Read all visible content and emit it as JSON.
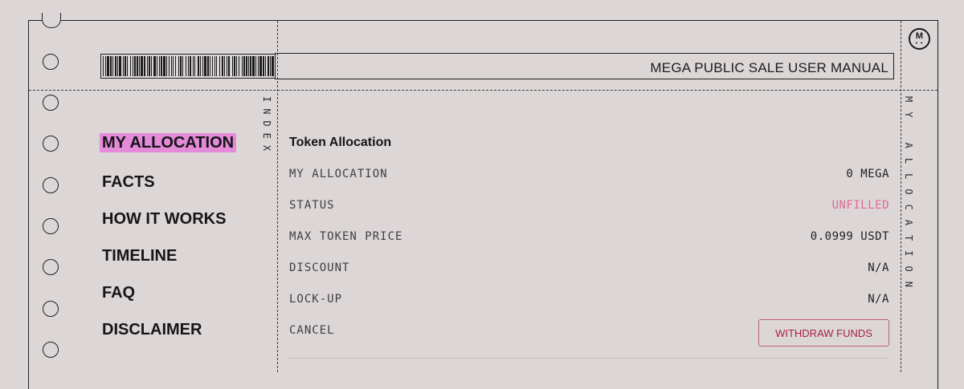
{
  "header": {
    "title": "MEGA PUBLIC SALE USER MANUAL",
    "logo_letter": "M",
    "logo_dots": "• •"
  },
  "index_label": "INDEX",
  "side_label": "MY ALLOCATION",
  "nav": {
    "items": [
      {
        "label": "MY ALLOCATION",
        "active": true
      },
      {
        "label": "FACTS",
        "active": false
      },
      {
        "label": "HOW IT WORKS",
        "active": false
      },
      {
        "label": "TIMELINE",
        "active": false
      },
      {
        "label": "FAQ",
        "active": false
      },
      {
        "label": "DISCLAIMER",
        "active": false
      }
    ]
  },
  "allocation": {
    "title": "Token Allocation",
    "rows": [
      {
        "label": "MY ALLOCATION",
        "value": "0 MEGA"
      },
      {
        "label": "STATUS",
        "value": "UNFILLED"
      },
      {
        "label": "MAX TOKEN PRICE",
        "value": "0.0999 USDT"
      },
      {
        "label": "DISCOUNT",
        "value": "N/A"
      },
      {
        "label": "LOCK-UP",
        "value": "N/A"
      },
      {
        "label": "CANCEL",
        "value": ""
      }
    ],
    "withdraw_button": "WITHDRAW FUNDS"
  },
  "colors": {
    "background": "#dcd7d6",
    "active_highlight": "#e48ad8",
    "status_unfilled": "#e2689b",
    "withdraw_text": "#a61f4b",
    "ink": "#19191b"
  }
}
